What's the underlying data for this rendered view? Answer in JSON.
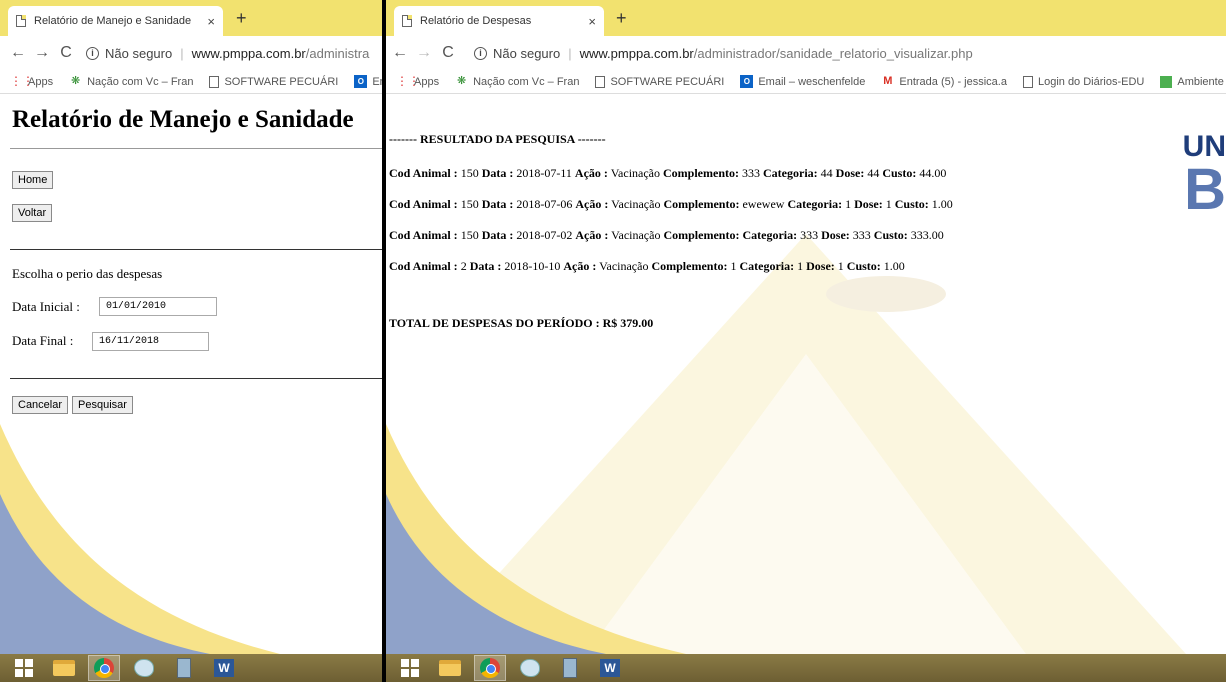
{
  "left_window": {
    "tab_title": "Relatório de Manejo e Sanidade",
    "tab_close": "×",
    "new_tab": "+",
    "security_label": "Não seguro",
    "url_host": "www.pmppa.com.br",
    "url_path": "/administra",
    "bookmarks": [
      "Apps",
      "Nação com Vc – Fran",
      "SOFTWARE PECUÁRI",
      "En"
    ],
    "page": {
      "title": "Relatório de Manejo e Sanidade",
      "home_button": "Home",
      "back_button": "Voltar",
      "choose_label": "Escolha o perio das despesas",
      "start_label": "Data Inicial :",
      "start_value": "01/01/2010",
      "end_label": "Data Final :",
      "end_value": "16/11/2018",
      "cancel_button": "Cancelar",
      "search_button": "Pesquisar"
    }
  },
  "right_window": {
    "tab_title": "Relatório de Despesas",
    "tab_close": "×",
    "new_tab": "+",
    "security_label": "Não seguro",
    "url_host": "www.pmppa.com.br",
    "url_path": "/administrador/sanidade_relatorio_visualizar.php",
    "bookmarks": [
      "Apps",
      "Nação com Vc – Fran",
      "SOFTWARE PECUÁRI",
      "Email – weschenfelde",
      "Entrada (5) - jessica.a",
      "Login do Diários-EDU",
      "Ambiente Vi"
    ],
    "page": {
      "result_header": "------- RESULTADO DA PESQUISA -------",
      "logo_text_1": "UN",
      "logo_text_2": "B",
      "labels": {
        "cod": "Cod Animal :",
        "data": "Data :",
        "acao": "Ação :",
        "complemento": "Complemento:",
        "categoria": "Categoria:",
        "dose": "Dose:",
        "custo": "Custo:"
      },
      "rows": [
        {
          "cod": "150",
          "data": "2018-07-11",
          "acao": "Vacinação",
          "complemento": "333",
          "categoria": "44",
          "dose": "44",
          "custo": "44.00"
        },
        {
          "cod": "150",
          "data": "2018-07-06",
          "acao": "Vacinação",
          "complemento": "ewewew",
          "categoria": "1",
          "dose": "1",
          "custo": "1.00"
        },
        {
          "cod": "150",
          "data": "2018-07-02",
          "acao": "Vacinação",
          "complemento": "",
          "categoria": "333",
          "dose": "333",
          "custo": "333.00"
        },
        {
          "cod": "2",
          "data": "2018-10-10",
          "acao": "Vacinação",
          "complemento": "1",
          "categoria": "1",
          "dose": "1",
          "custo": "1.00"
        }
      ],
      "total": "TOTAL DE DESPESAS DO PERÍODO : R$ 379.00"
    }
  },
  "colors": {
    "tabstrip": "#f2e26f",
    "bg_yellow": "#f7e38a",
    "bg_blue": "#8fa2c9",
    "taskbar": "#7a6b3c"
  },
  "taskbar_icons": [
    "windows-start-icon",
    "file-explorer-icon",
    "chrome-icon",
    "paint-icon",
    "calculator-icon",
    "word-icon"
  ],
  "word_letter": "W"
}
